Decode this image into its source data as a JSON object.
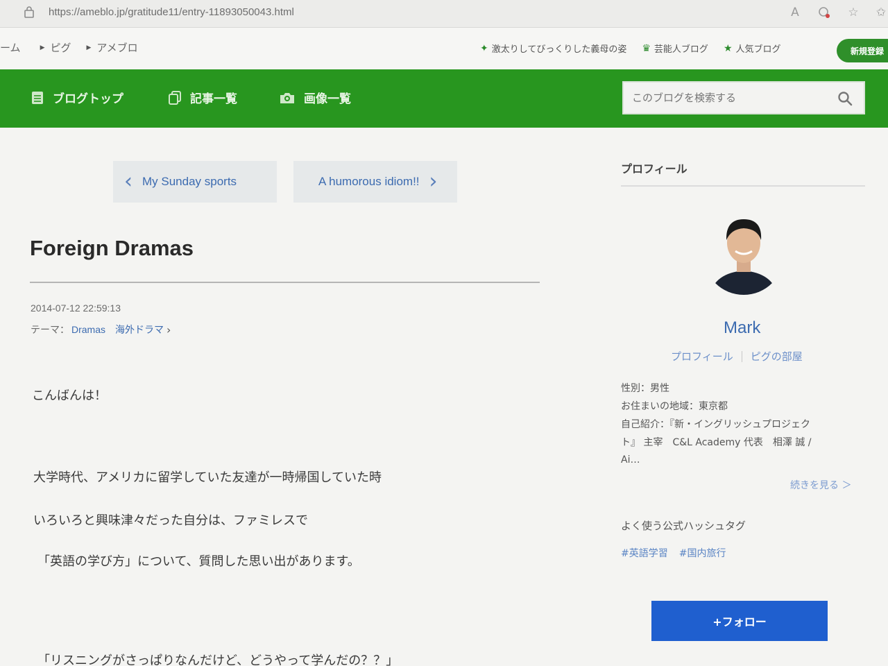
{
  "browser": {
    "url": "https://ameblo.jp/gratitude11/entry-11893050043.html",
    "icons": [
      "lock-icon",
      "read-aloud-icon",
      "extension-icon",
      "favorite-add-icon",
      "favorites-icon"
    ]
  },
  "topbar": {
    "breadcrumbs": [
      "ーム",
      "ピグ",
      "アメブロ"
    ],
    "links": [
      {
        "icon": "sparkle-icon",
        "label": "激太りしてびっくりした義母の姿"
      },
      {
        "icon": "crown-icon",
        "label": "芸能人ブログ"
      },
      {
        "icon": "star-icon",
        "label": "人気ブログ"
      }
    ],
    "login_label": "新規登録"
  },
  "blog_nav": {
    "items": [
      "ブログトップ",
      "記事一覧",
      "画像一覧"
    ],
    "search_placeholder": "このブログを検索する"
  },
  "article": {
    "prev_label": "My Sunday sports",
    "next_label": "A humorous idiom!!",
    "title": "Foreign Dramas",
    "datetime": "2014-07-12 22:59:13",
    "theme_prefix": "テーマ：",
    "theme": "Dramas",
    "theme_category": "海外ドラマ",
    "paragraphs": [
      "こんばんは！",
      "大学時代、アメリカに留学していた友達が一時帰国していた時",
      "いろいろと興味津々だった自分は、ファミレスで",
      "「英語の学び方」について、質問した思い出があります。",
      "「リスニングがさっぱりなんだけど、どうやって学んだの？？」"
    ]
  },
  "sidebar": {
    "heading": "プロフィール",
    "name": "Mark",
    "profile_link": "プロフィール",
    "pigg_link": "ピグの部屋",
    "info": [
      "性別：男性",
      "お住まいの地域：東京都",
      "自己紹介：『新・イングリッシュプロジェク",
      "ト』 主宰　C&L Academy 代表　相澤 誠 /",
      "Ai…"
    ],
    "more_label": "続きを見る ＞",
    "tags_heading": "よく使う公式ハッシュタグ",
    "tags": [
      "#英語学習",
      "#国内旅行"
    ],
    "follow_label": "+フォロー"
  },
  "colors": {
    "ameba_green": "#28961f",
    "link_blue": "#3c6bb0",
    "follow_blue": "#1f5fcf"
  }
}
